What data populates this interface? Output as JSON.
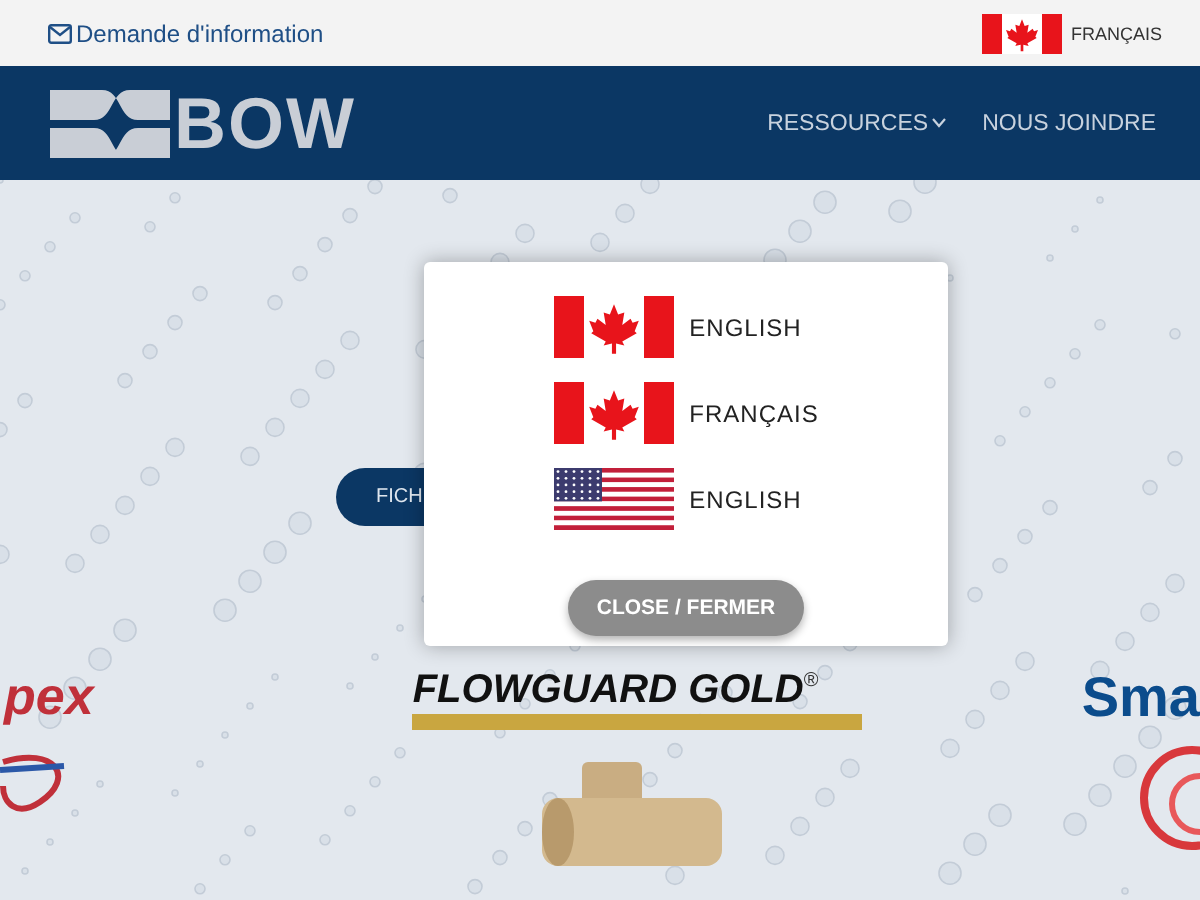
{
  "top_bar": {
    "inquiry_link": "Demande d'information",
    "language_link": {
      "label": "FRANÇAIS",
      "kind": "ca"
    }
  },
  "header": {
    "logo": "BOW",
    "nav": [
      {
        "label": "RESSOURCES",
        "dropdown": true
      },
      {
        "label": "NOUS JOINDRE",
        "dropdown": false
      }
    ]
  },
  "hero": {
    "button": "FICH"
  },
  "brands": [
    {
      "kind": "pex",
      "name": "pex"
    },
    {
      "kind": "flowguard",
      "name": "FLOWGUARD GOLD",
      "mark": "®"
    },
    {
      "kind": "smart",
      "name": "Sma"
    }
  ],
  "language_dialog": {
    "options": [
      {
        "kind": "ca",
        "label": "ENGLISH"
      },
      {
        "kind": "ca",
        "label": "FRANÇAIS"
      },
      {
        "kind": "us",
        "label": "ENGLISH"
      }
    ],
    "close_button": "CLOSE / FERMER"
  }
}
